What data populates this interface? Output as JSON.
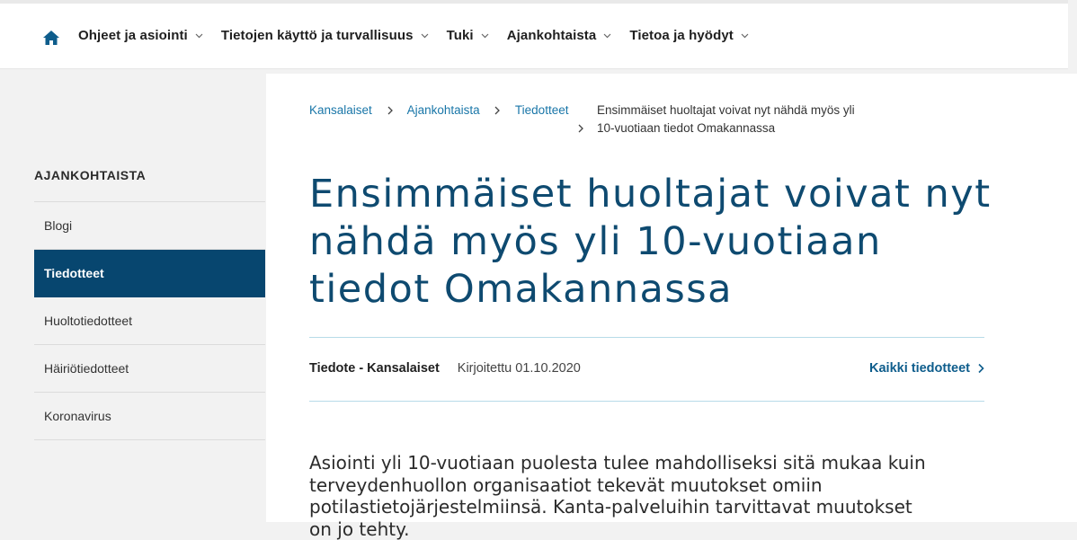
{
  "nav": {
    "items": [
      {
        "label": "Ohjeet ja asiointi"
      },
      {
        "label": "Tietojen käyttö ja turvallisuus"
      },
      {
        "label": "Tuki"
      },
      {
        "label": "Ajankohtaista"
      },
      {
        "label": "Tietoa ja hyödyt"
      }
    ],
    "home_icon": "home-icon",
    "chevron_icon": "chevron-down-icon"
  },
  "sidebar": {
    "title": "AJANKOHTAISTA",
    "items": [
      {
        "label": "Blogi",
        "active": false
      },
      {
        "label": "Tiedotteet",
        "active": true
      },
      {
        "label": "Huoltotiedotteet",
        "active": false
      },
      {
        "label": "Häiriötiedotteet",
        "active": false
      },
      {
        "label": "Koronavirus",
        "active": false
      }
    ]
  },
  "breadcrumb": {
    "links": [
      "Kansalaiset",
      "Ajankohtaista",
      "Tiedotteet"
    ],
    "current_line1": "Ensimmäiset huoltajat voivat nyt nähdä myös yli",
    "current_line2": "10-vuotiaan tiedot Omakannassa"
  },
  "article": {
    "title": "Ensimmäiset huoltajat voivat nyt nähdä myös yli 10-vuotiaan tiedot Omakannassa",
    "type": "Tiedote - Kansalaiset",
    "date": "Kirjoitettu 01.10.2020",
    "all_link": "Kaikki tiedotteet",
    "lead": "Asiointi yli 10-vuotiaan puolesta tulee mahdolliseksi sitä mukaa kuin terveydenhuollon organisaatiot tekevät muutokset omiin potilastietojärjestelmiinsä. Kanta-palveluihin tarvittavat muutokset on jo tehty."
  },
  "colors": {
    "brand_dark": "#07466f",
    "title_blue": "#0e4a70",
    "link_blue": "#1976a8",
    "divider": "#b7dbe8"
  }
}
